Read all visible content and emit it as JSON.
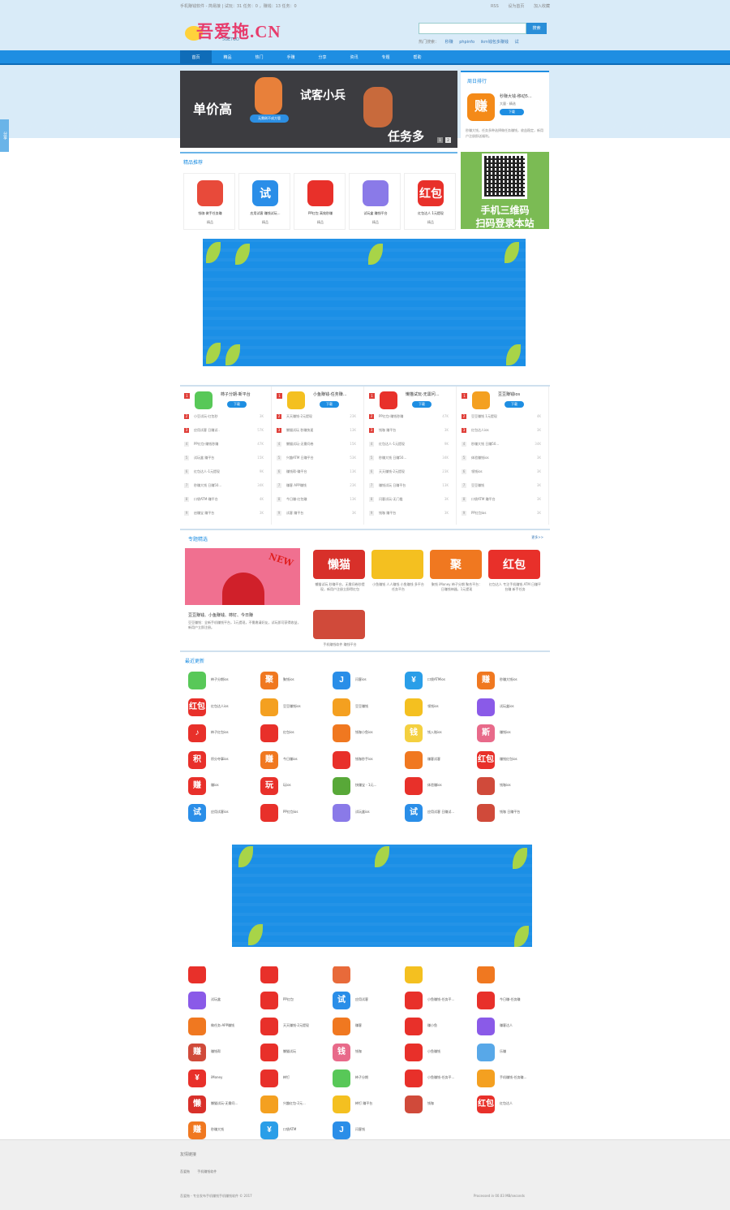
{
  "topbar": {
    "left": "手机赚钱软件 - 简易接 | 试玩：31 任务：0 ，赚钱：13 任务：0",
    "links": [
      "RSS",
      "设为首页",
      "加入收藏"
    ]
  },
  "logo": {
    "text": "吾爱拖.CN",
    "sub": "5GETUO"
  },
  "search": {
    "placeholder": "",
    "button": "搜索"
  },
  "hot": {
    "label": "热门搜索：",
    "items": [
      "秒赚",
      "phpinfo",
      "ikm钱包多赚钱",
      "试"
    ]
  },
  "nav": [
    "首页",
    "精品",
    "热门",
    "手赚",
    "分享",
    "资讯",
    "专题",
    "帮助"
  ],
  "sidetab": "分享",
  "banner": {
    "left": "单价高",
    "mid": "试客小兵",
    "pill": "无需刷不成方管",
    "right": "任务多",
    "dots": [
      "1",
      "2"
    ]
  },
  "rank": {
    "title": "周日排行",
    "name": "秒赚大钱-移动5...",
    "tag": "大量 · 精选",
    "dl": "下载",
    "desc": "秒赚大钱，任务多种选择做任务赚钱，收益稳定，新用户注册即送福利。"
  },
  "picks": {
    "title": "精品推荐",
    "items": [
      {
        "name": "钱咖 做手任务赚",
        "sub": "精品",
        "color": "#e84a3a",
        "glyph": ""
      },
      {
        "name": "应用试客 赚钱试玩...",
        "sub": "精品",
        "color": "#2a8ee8",
        "glyph": "试"
      },
      {
        "name": "PP红包 高效秒赚",
        "sub": "精品",
        "color": "#e8302a",
        "glyph": ""
      },
      {
        "name": "试玩盒 赚钱平台",
        "sub": "精品",
        "color": "#8a7ae8",
        "glyph": ""
      },
      {
        "name": "红包达人 1元提现",
        "sub": "精品",
        "color": "#e8302a",
        "glyph": "红包"
      }
    ]
  },
  "qr": {
    "line1": "手机三维码",
    "line2": "扫码登录本站"
  },
  "cols": [
    {
      "name": "柿子分期-新平台",
      "color": "#58c858",
      "rows": [
        "小豆试玩-红包秒",
        "应用试客 日赚试..",
        "PP红包-赚钱秒赚",
        "试玩盒 赚平台",
        "红包达人-1元提现",
        "秒赚大钱 日赚50...",
        "口袋ATM-赚平台",
        "启赚宝 赚平台"
      ],
      "vals": [
        "3K",
        "57K",
        "47K",
        "15K",
        "9K",
        "34K",
        "4K",
        "3K"
      ]
    },
    {
      "name": "小鱼赚钱-任务赚...",
      "color": "#f4c020",
      "rows": [
        "天天赚钱-2元提现",
        "懒猫试玩 秒赚快速",
        "懒猫试玩-无需问卷",
        "兴趣ATM 日赚平台",
        "赚钱帮-赚平台",
        "赚客 APP赚钱",
        "今日赚-红包赚",
        "试客 赚平台"
      ],
      "vals": [
        "23K",
        "13K",
        "15K",
        "53K",
        "13K",
        "23K",
        "13K",
        "3K"
      ]
    },
    {
      "name": "懒猫试玩-无需问...",
      "color": "#e8302a",
      "rows": [
        "PP红包-赚钱秒赚",
        "钱咖 赚平台",
        "红包达人-1元提现",
        "秒赚大钱 日赚50...",
        "天天赚钱-2元提现",
        "赚钱试玩 日赚平台",
        "闪客试玩-无门槛",
        "钱咖 赚平台"
      ],
      "vals": [
        "47K",
        "3K",
        "9K",
        "34K",
        "23K",
        "13K",
        "3K",
        "3K"
      ]
    },
    {
      "name": "豆豆赚钱ios",
      "color": "#f4a020",
      "rows": [
        "豆豆赚钱 1元提现",
        "红包达人ios",
        "秒赚大钱 日赚50...",
        "体验赚钱ios",
        "领钱ios",
        "豆豆赚钱",
        "口袋ATM 赚平台",
        "PP红包ios"
      ],
      "vals": [
        "4K",
        "3K",
        "34K",
        "3K",
        "3K",
        "3K",
        "3K",
        "3K"
      ]
    }
  ],
  "topic": {
    "title": "专题精选",
    "more": "更多>>",
    "new": "NEW",
    "big_title": "豆豆赚钱、小鱼赚钱、柿钉、今日赚",
    "big_desc": "豆豆赚钱：全新手机赚钱平台，1元提现，不需邀请好友，试玩即可获得收益，新用户立即注册。",
    "items": [
      {
        "glyph": "懒猫",
        "color": "#d8302a",
        "desc": "懒猫试玩 秒赚平台，无需问卷秒提现，新用户注册立即得红包"
      },
      {
        "glyph": "",
        "color": "#f4c020",
        "desc": "小鱼赚钱 人人赚钱 小鱼赚钱 多平台任务平台"
      },
      {
        "glyph": "聚",
        "color": "#f07820",
        "desc": "聚钱 iMoney 柿子分期 聚合平台：日赚钱神器，1元提现"
      },
      {
        "glyph": "红包",
        "color": "#e8302a",
        "desc": "红包达人 专注手机赚钱 ATM 日赚平台赚 新手任务"
      },
      {
        "glyph": "",
        "color": "#d04a3a",
        "desc": "手机赚钱软件 赚钱平台"
      }
    ]
  },
  "recent": {
    "title": "最近更新",
    "apps": [
      {
        "n": "柿子分期ios",
        "c": "#58c858",
        "g": ""
      },
      {
        "n": "聚钱ios",
        "c": "#f07820",
        "g": "聚"
      },
      {
        "n": "闪客ios",
        "c": "#2a8ee8",
        "g": "J"
      },
      {
        "n": "口袋ATMios",
        "c": "#2a9ee8",
        "g": "¥"
      },
      {
        "n": "秒赚大钱ios",
        "c": "#f07820",
        "g": "赚"
      },
      {
        "n": "红包达人ios",
        "c": "#e8302a",
        "g": "红包"
      },
      {
        "n": "豆豆赚钱ios",
        "c": "#f4a020",
        "g": ""
      },
      {
        "n": "豆豆赚钱",
        "c": "#f4a020",
        "g": ""
      },
      {
        "n": "领钱ios",
        "c": "#f4c020",
        "g": ""
      },
      {
        "n": "试玩盒ios",
        "c": "#8a5ae8",
        "g": ""
      },
      {
        "n": "柿子红包ios",
        "c": "#e8302a",
        "g": "♪"
      },
      {
        "n": "红包ios",
        "c": "#e8302a",
        "g": ""
      },
      {
        "n": "钱咖小鱼ios",
        "c": "#f07820",
        "g": ""
      },
      {
        "n": "钱入账ios",
        "c": "#f4d040",
        "g": "钱"
      },
      {
        "n": "赚钱ios",
        "c": "#e86a8a",
        "g": "斯"
      },
      {
        "n": "积分夺事ios",
        "c": "#e8302a",
        "g": "积"
      },
      {
        "n": "今日赚ios",
        "c": "#f07820",
        "g": "赚"
      },
      {
        "n": "钱咖秒手ios",
        "c": "#e8302a",
        "g": ""
      },
      {
        "n": "赚客试客",
        "c": "#f07820",
        "g": ""
      },
      {
        "n": "赚钱红包ios",
        "c": "#e8302a",
        "g": "红包"
      },
      {
        "n": "赚ios",
        "c": "#e8302a",
        "g": "赚"
      },
      {
        "n": "玩ios",
        "c": "#e8302a",
        "g": "玩"
      },
      {
        "n": "快赚宝 - 1元...",
        "c": "#58a838",
        "g": ""
      },
      {
        "n": "体验赚ios",
        "c": "#e8302a",
        "g": ""
      },
      {
        "n": "钱咖ios",
        "c": "#d04a3a",
        "g": ""
      },
      {
        "n": "应用试客ios",
        "c": "#2a8ee8",
        "g": "试"
      },
      {
        "n": "PP红包ios",
        "c": "#e8302a",
        "g": ""
      },
      {
        "n": "试玩盒ios",
        "c": "#8a7ae8",
        "g": ""
      },
      {
        "n": "应用试客 日赚试...",
        "c": "#2a8ee8",
        "g": "试"
      },
      {
        "n": "钱咖 日赚平台",
        "c": "#d04a3a",
        "g": ""
      },
      {
        "n": "",
        "c": "#e8302a",
        "g": ""
      },
      {
        "n": "",
        "c": "#e8302a",
        "g": ""
      },
      {
        "n": "",
        "c": "#e86a3a",
        "g": ""
      },
      {
        "n": "",
        "c": "#f4c020",
        "g": ""
      },
      {
        "n": "",
        "c": "#f07820",
        "g": ""
      },
      {
        "n": "试玩盒",
        "c": "#8a5ae8",
        "g": ""
      },
      {
        "n": "PP红包",
        "c": "#e8302a",
        "g": ""
      },
      {
        "n": "应用试客",
        "c": "#2a8ee8",
        "g": "试"
      },
      {
        "n": "小鱼赚钱-任务平...",
        "c": "#e8302a",
        "g": ""
      },
      {
        "n": "今日赚-任务赚",
        "c": "#e8302a",
        "g": ""
      },
      {
        "n": "做任务-APP赚钱",
        "c": "#f07820",
        "g": ""
      },
      {
        "n": "天天赚钱-2元提现",
        "c": "#e8302a",
        "g": ""
      },
      {
        "n": "赚客",
        "c": "#f07820",
        "g": ""
      },
      {
        "n": "赚小鱼",
        "c": "#e8302a",
        "g": ""
      },
      {
        "n": "赚客达人",
        "c": "#8a5ae8",
        "g": ""
      },
      {
        "n": "赚钱帮",
        "c": "#d04a3a",
        "g": "赚"
      },
      {
        "n": "懒猫试玩",
        "c": "#e8302a",
        "g": ""
      },
      {
        "n": "钱咖",
        "c": "#e86a8a",
        "g": "钱"
      },
      {
        "n": "小鱼赚钱",
        "c": "#e8302a",
        "g": ""
      },
      {
        "n": "乐赚",
        "c": "#58a8e8",
        "g": ""
      },
      {
        "n": "iMoney",
        "c": "#e8302a",
        "g": "¥"
      },
      {
        "n": "柿钉",
        "c": "#e8302a",
        "g": ""
      },
      {
        "n": "柿子分期",
        "c": "#58c858",
        "g": ""
      },
      {
        "n": "小鱼赚钱-任务平...",
        "c": "#e8302a",
        "g": ""
      },
      {
        "n": "手机赚钱-任务赚...",
        "c": "#f4a020",
        "g": ""
      },
      {
        "n": "懒猫试玩-无需问...",
        "c": "#d8302a",
        "g": "懒"
      },
      {
        "n": "兴趣红包-2元...",
        "c": "#f4a020",
        "g": ""
      },
      {
        "n": "柿钉 赚平台",
        "c": "#f4c020",
        "g": ""
      },
      {
        "n": "钱咖",
        "c": "#d04a3a",
        "g": ""
      },
      {
        "n": "红包达人",
        "c": "#e8302a",
        "g": "红包"
      },
      {
        "n": "秒赚大钱",
        "c": "#f07820",
        "g": "赚"
      },
      {
        "n": "口袋ATM",
        "c": "#2a9ee8",
        "g": "¥"
      },
      {
        "n": "闪客钱",
        "c": "#2a8ee8",
        "g": "J"
      }
    ]
  },
  "footer": {
    "friends": "友情链接",
    "links": [
      "吾爱拖",
      "手机赚钱软件"
    ],
    "copy": "吾爱拖 - 专业发布手机赚钱手机赚钱软件 © 2017",
    "proc": "Processed in 00.03 MB/seconds"
  }
}
